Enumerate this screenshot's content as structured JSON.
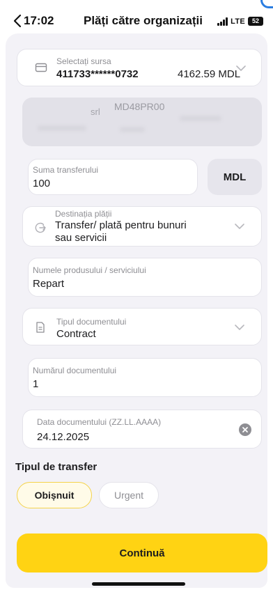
{
  "status": {
    "time": "17:02",
    "network": "LTE",
    "battery": "52"
  },
  "header": {
    "title": "Plăți către organizații"
  },
  "source": {
    "label": "Selectați sursa",
    "card_number": "411733******0732",
    "balance": "4162.59 MDL"
  },
  "beneficiary": {
    "name_suffix": "srl",
    "iban_prefix": "MD48PR00"
  },
  "amount": {
    "label": "Suma transferului",
    "value": "100",
    "currency": "MDL"
  },
  "destination": {
    "label": "Destinația plății",
    "value_line1": "Transfer/ plată pentru bunuri",
    "value_line2": "sau servicii"
  },
  "product": {
    "label": "Numele produsului / serviciului",
    "value": "Repart"
  },
  "document_type": {
    "label": "Tipul documentului",
    "value": "Contract"
  },
  "document_number": {
    "label": "Numărul documentului",
    "value": "1"
  },
  "document_date": {
    "label": "Data documentului (ZZ.LL.AAAA)",
    "value": "24.12.2025"
  },
  "transfer_type": {
    "title": "Tipul de transfer",
    "options": [
      {
        "label": "Obișnuit",
        "selected": true
      },
      {
        "label": "Urgent",
        "selected": false
      }
    ]
  },
  "actions": {
    "continue_label": "Continuă"
  },
  "colors": {
    "accent": "#ffd313",
    "selected_pill_border": "#f4d34a",
    "sheet_background": "#f3f2f7"
  },
  "icons": {
    "back": "chevron-left-icon",
    "source": "card-icon",
    "destination": "arrow-circle-icon",
    "document_type": "document-icon",
    "select": "chevron-down-icon",
    "clear": "clear-icon"
  }
}
